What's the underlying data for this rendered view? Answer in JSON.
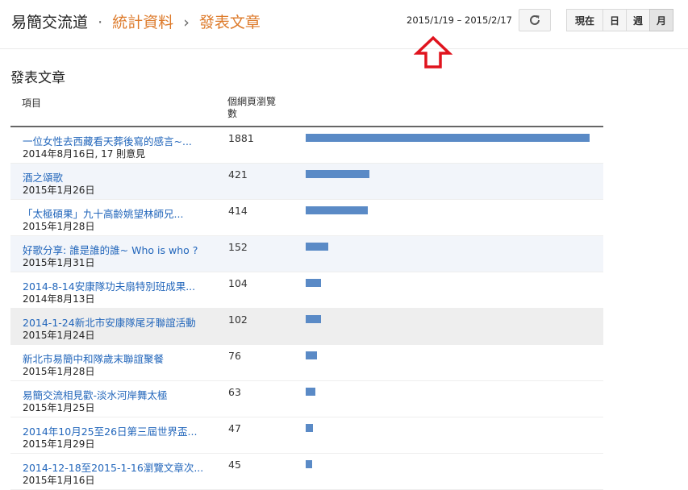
{
  "breadcrumb": {
    "blog": "易簡交流道",
    "separator_1": "·",
    "stats": "統計資料",
    "separator_2": "›",
    "current": "發表文章"
  },
  "date_range": "2015/1/19 – 2015/2/17",
  "icons": {
    "refresh": "refresh-icon",
    "annotation": "red-up-arrow-icon"
  },
  "colors": {
    "accent": "#dd7a2a",
    "link": "#2266bb",
    "bar": "#5a8ac6",
    "annotation": "#e0141e"
  },
  "period_buttons": [
    "現在",
    "日",
    "週",
    "月"
  ],
  "active_period": "月",
  "section_title": "發表文章",
  "columns": {
    "item": "項目",
    "views_line1": "個網頁瀏覽",
    "views_line2": "數"
  },
  "rows": [
    {
      "title": "一位女性去西藏看天葬後寫的感言~...",
      "sub": "2014年8月16日, 17 則意見",
      "views": "1881"
    },
    {
      "title": "酒之頌歌",
      "sub": "2015年1月26日",
      "views": "421"
    },
    {
      "title": "「太極碩果」九十高齡姚望林師兄...",
      "sub": "2015年1月28日",
      "views": "414"
    },
    {
      "title": "好歌分享: 誰是誰的誰~ Who is who ?",
      "sub": "2015年1月31日",
      "views": "152"
    },
    {
      "title": "2014-8-14安康隊功夫扇特別班成果...",
      "sub": "2014年8月13日",
      "views": "104"
    },
    {
      "title": "2014-1-24新北市安康隊尾牙聯誼活動",
      "sub": "2015年1月24日",
      "views": "102"
    },
    {
      "title": "新北市易簡中和隊歲末聯誼聚餐",
      "sub": "2015年1月28日",
      "views": "76"
    },
    {
      "title": "易簡交流相見歡-淡水河岸舞太極",
      "sub": "2015年1月25日",
      "views": "63"
    },
    {
      "title": "2014年10月25至26日第三屆世界盃...",
      "sub": "2015年1月29日",
      "views": "47"
    },
    {
      "title": "2014-12-18至2015-1-16瀏覽文章次...",
      "sub": "2015年1月16日",
      "views": "45"
    }
  ]
}
